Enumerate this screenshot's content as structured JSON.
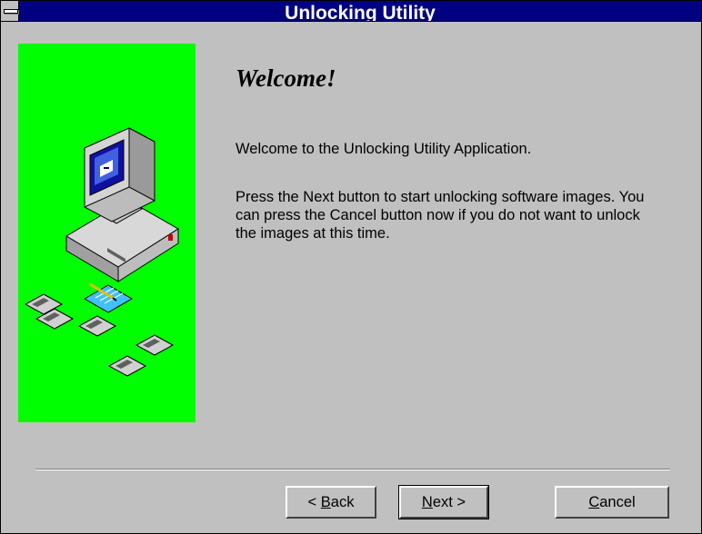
{
  "window": {
    "title": "Unlocking Utility"
  },
  "icons": {
    "system_menu": "system-menu-icon",
    "illustration": "computer-with-floppy-disks-illustration"
  },
  "colors": {
    "titlebar": "#000080",
    "window_bg": "#c0c0c0",
    "illustration_bg": "#00ff00"
  },
  "content": {
    "heading": "Welcome!",
    "paragraph1": "Welcome to the Unlocking Utility Application.",
    "paragraph2": "Press the Next button to start unlocking software images. You can press the Cancel button now if you do not want to unlock the images at this time."
  },
  "buttons": {
    "back": {
      "prefix": "< ",
      "mnemonic": "B",
      "rest": "ack"
    },
    "next": {
      "mnemonic": "N",
      "rest": "ext",
      "suffix": " >"
    },
    "cancel": {
      "mnemonic": "C",
      "rest": "ancel"
    }
  }
}
